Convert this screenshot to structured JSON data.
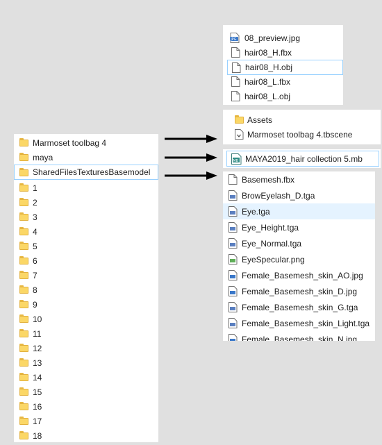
{
  "left_panel": {
    "items": [
      {
        "label": "Marmoset toolbag 4"
      },
      {
        "label": "maya"
      },
      {
        "label": "SharedFilesTexturesBasemodel"
      },
      {
        "label": "1"
      },
      {
        "label": "2"
      },
      {
        "label": "3"
      },
      {
        "label": "4"
      },
      {
        "label": "5"
      },
      {
        "label": "6"
      },
      {
        "label": "7"
      },
      {
        "label": "8"
      },
      {
        "label": "9"
      },
      {
        "label": "10"
      },
      {
        "label": "11"
      },
      {
        "label": "12"
      },
      {
        "label": "13"
      },
      {
        "label": "14"
      },
      {
        "label": "15"
      },
      {
        "label": "16"
      },
      {
        "label": "17"
      },
      {
        "label": "18"
      }
    ]
  },
  "hair_panel": {
    "items": [
      {
        "label": "08_preview.jpg",
        "icon": "jpg-file-icon"
      },
      {
        "label": "hair08_H.fbx",
        "icon": "file-icon"
      },
      {
        "label": "hair08_H.obj",
        "icon": "file-icon"
      },
      {
        "label": "hair08_L.fbx",
        "icon": "file-icon"
      },
      {
        "label": "hair08_L.obj",
        "icon": "file-icon"
      }
    ]
  },
  "marmoset_panel": {
    "items": [
      {
        "label": "Assets",
        "icon": "folder-icon"
      },
      {
        "label": "Marmoset toolbag 4.tbscene",
        "icon": "tbscene-file-icon"
      }
    ]
  },
  "maya_panel": {
    "items": [
      {
        "label": "MAYA2019_hair collection 5.mb",
        "icon": "maya-file-icon"
      }
    ]
  },
  "textures_panel": {
    "items": [
      {
        "label": "Basemesh.fbx",
        "icon": "file-icon"
      },
      {
        "label": "BrowEyelash_D.tga",
        "icon": "tga-file-icon"
      },
      {
        "label": "Eye.tga",
        "icon": "tga-file-icon"
      },
      {
        "label": "Eye_Height.tga",
        "icon": "tga-file-icon"
      },
      {
        "label": "Eye_Normal.tga",
        "icon": "tga-file-icon"
      },
      {
        "label": "EyeSpecular.png",
        "icon": "png-file-icon"
      },
      {
        "label": "Female_Basemesh_skin_AO.jpg",
        "icon": "jpg-file-icon"
      },
      {
        "label": "Female_Basemesh_skin_D.jpg",
        "icon": "jpg-file-icon"
      },
      {
        "label": "Female_Basemesh_skin_G.tga",
        "icon": "tga-file-icon"
      },
      {
        "label": "Female_Basemesh_skin_Light.tga",
        "icon": "tga-file-icon"
      },
      {
        "label": "Female_Basemesh_skin_N.jpg",
        "icon": "jpg-file-icon"
      }
    ]
  },
  "colors": {
    "background": "#e0e0e0",
    "panel": "#ffffff",
    "selection_fill": "#e5f3ff",
    "selection_border": "#99d1ff",
    "folder": "#fbd766",
    "arrow": "#000000"
  }
}
